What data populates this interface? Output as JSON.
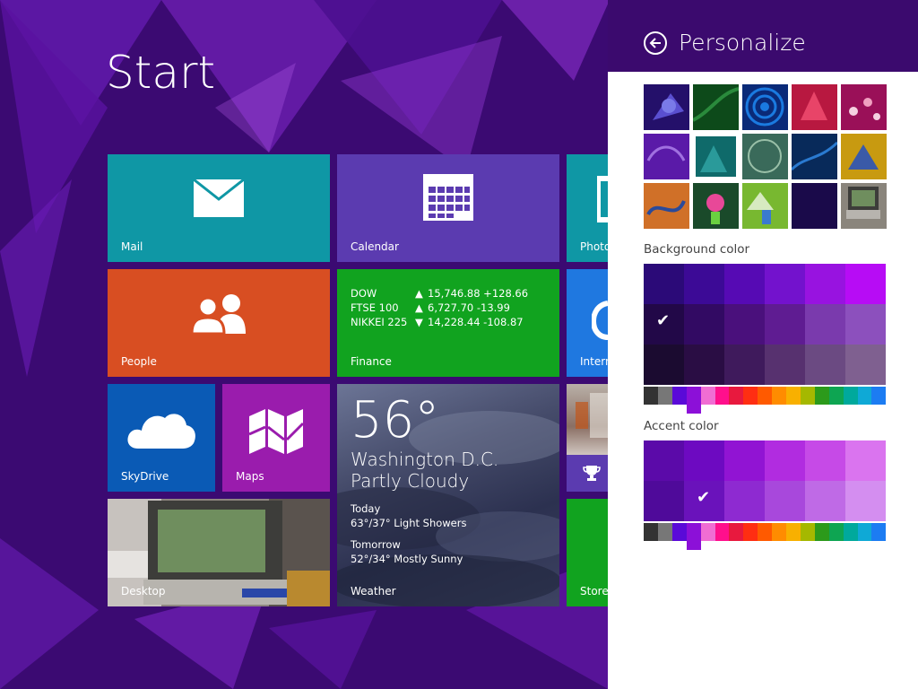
{
  "start": {
    "title": "Start"
  },
  "tiles": {
    "mail": {
      "label": "Mail",
      "color": "#0f97a5"
    },
    "calendar": {
      "label": "Calendar",
      "color": "#5b3bb0"
    },
    "photos": {
      "label": "Photo",
      "color": "#0f97a5"
    },
    "people": {
      "label": "People",
      "color": "#d84e22"
    },
    "finance": {
      "label": "Finance",
      "color": "#11a31f",
      "rows": [
        {
          "name": "DOW",
          "dir": "▲",
          "value": "15,746.88 +128.66"
        },
        {
          "name": "FTSE 100",
          "dir": "▲",
          "value": "6,727.70 -13.99"
        },
        {
          "name": "NIKKEI 225",
          "dir": "▼",
          "value": "14,228.44 -108.87"
        }
      ]
    },
    "ie": {
      "label": "Intern",
      "color": "#1f78e0"
    },
    "skydrive": {
      "label": "SkyDrive",
      "color": "#0a5ab5"
    },
    "maps": {
      "label": "Maps",
      "color": "#9a1cad"
    },
    "weather": {
      "label": "Weather",
      "temp": "56°",
      "city": "Washington D.C.",
      "condition": "Partly Cloudy",
      "today_label": "Today",
      "today": "63°/37° Light Showers",
      "tomorrow_label": "Tomorrow",
      "tomorrow": "52°/34° Mostly Sunny"
    },
    "games": {
      "color": "#5b3bb0"
    },
    "desktop": {
      "label": "Desktop"
    },
    "store": {
      "label": "Store",
      "color": "#11a31f"
    }
  },
  "panel": {
    "title": "Personalize",
    "header_color": "#3b0a6e",
    "background_label": "Background color",
    "accent_label": "Accent color",
    "background_grid": [
      [
        "#2b0a78",
        "#3c0a96",
        "#560ab4",
        "#7312cd",
        "#9813e0",
        "#b70cf5"
      ],
      [
        "#220848",
        "#320a63",
        "#4a107c",
        "#5f1c92",
        "#7a3aad",
        "#8c50bd"
      ],
      [
        "#1b0b30",
        "#2a0d44",
        "#3f1a5c",
        "#57316f",
        "#6b4a82",
        "#7f6090"
      ]
    ],
    "background_selected": "row 2, column 1",
    "accent_grid": [
      [
        "#5b0aa9",
        "#6d0ac1",
        "#9114d3",
        "#b12ce0",
        "#c64ae7",
        "#da74ef"
      ],
      [
        "#4f0a9a",
        "#6a12bb",
        "#8e2ad1",
        "#a848dc",
        "#bf6ae6",
        "#d48ef0"
      ]
    ],
    "accent_selected": "row 2, column 2",
    "hue_strip": [
      "#333333",
      "#777777",
      "#5a0ad8",
      "#8c10d8",
      "#f06dd3",
      "#ff0f8c",
      "#e8193e",
      "#ff2e12",
      "#ff5a00",
      "#ff8c00",
      "#f8b000",
      "#a5b800",
      "#2c9a1b",
      "#0ea552",
      "#00a99c",
      "#0fa9d6",
      "#1c7cf2"
    ]
  }
}
